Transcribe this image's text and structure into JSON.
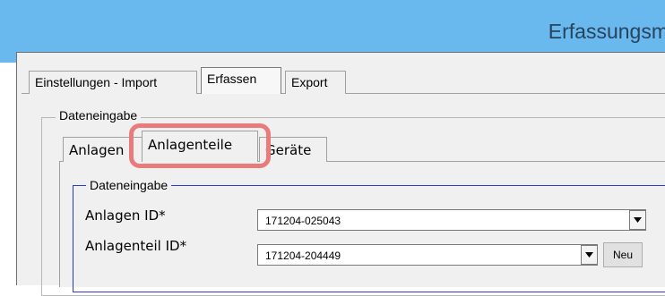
{
  "window": {
    "title": "Erfassungsm"
  },
  "main_tabs": [
    {
      "label": "Einstellungen - Import"
    },
    {
      "label": "Erfassen"
    },
    {
      "label": "Export"
    }
  ],
  "outer_group": {
    "legend": "Dateneingabe"
  },
  "sub_tabs": [
    {
      "label": "Anlagen"
    },
    {
      "label": "Anlagenteile"
    },
    {
      "label": "Geräte"
    }
  ],
  "inner_group": {
    "legend": "Dateneingabe"
  },
  "fields": {
    "anlagen_id": {
      "label": "Anlagen ID*",
      "value": "171204-025043"
    },
    "anlagenteil_id": {
      "label": "Anlagenteil ID*",
      "value": "171204-204449"
    }
  },
  "buttons": {
    "neu": "Neu"
  },
  "colors": {
    "titlebar": "#69b8ee",
    "highlight": "#ea7b7d",
    "group_border_blue": "#2c3bd1"
  }
}
